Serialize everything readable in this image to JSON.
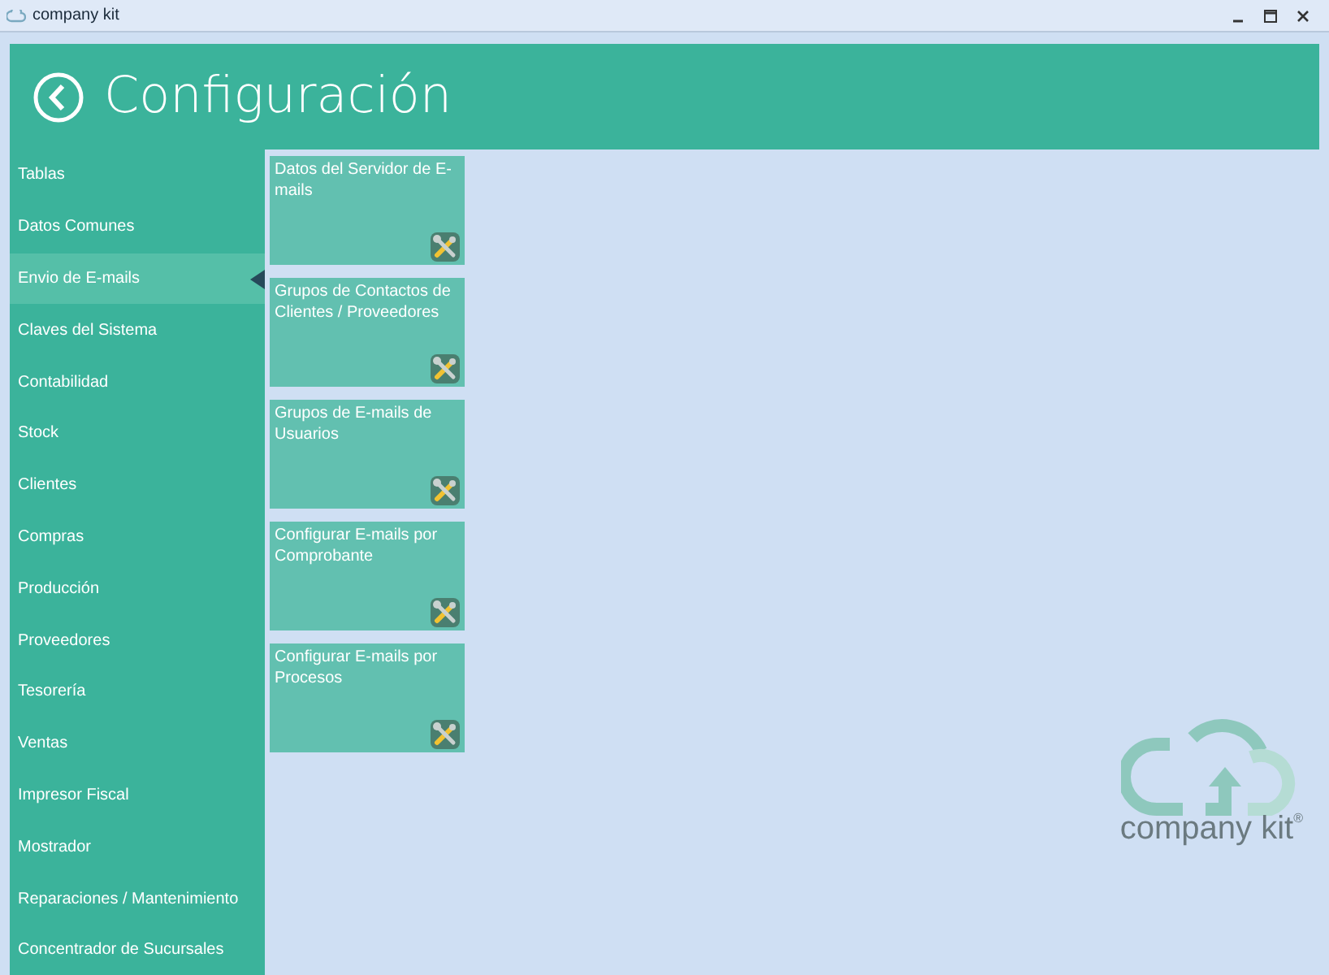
{
  "window": {
    "title": "company kit"
  },
  "header": {
    "title": "Configuración"
  },
  "sidebar": {
    "items": [
      {
        "label": "Tablas",
        "selected": false
      },
      {
        "label": "Datos Comunes",
        "selected": false
      },
      {
        "label": "Envio de E-mails",
        "selected": true
      },
      {
        "label": "Claves del Sistema",
        "selected": false
      },
      {
        "label": "Contabilidad",
        "selected": false
      },
      {
        "label": "Stock",
        "selected": false
      },
      {
        "label": "Clientes",
        "selected": false
      },
      {
        "label": "Compras",
        "selected": false
      },
      {
        "label": "Producción",
        "selected": false
      },
      {
        "label": "Proveedores",
        "selected": false
      },
      {
        "label": "Tesorería",
        "selected": false
      },
      {
        "label": "Ventas",
        "selected": false
      },
      {
        "label": "Impresor Fiscal",
        "selected": false
      },
      {
        "label": "Mostrador",
        "selected": false
      },
      {
        "label": "Reparaciones / Mantenimiento",
        "selected": false
      },
      {
        "label": "Concentrador de Sucursales",
        "selected": false
      }
    ]
  },
  "tiles": [
    {
      "label": "Datos del Servidor de E-mails"
    },
    {
      "label": "Grupos de Contactos de Clientes / Proveedores"
    },
    {
      "label": "Grupos de E-mails de Usuarios"
    },
    {
      "label": "Configurar E-mails por Comprobante"
    },
    {
      "label": "Configurar E-mails por Procesos"
    }
  ],
  "logo": {
    "name": "company kit",
    "mark": "®"
  }
}
